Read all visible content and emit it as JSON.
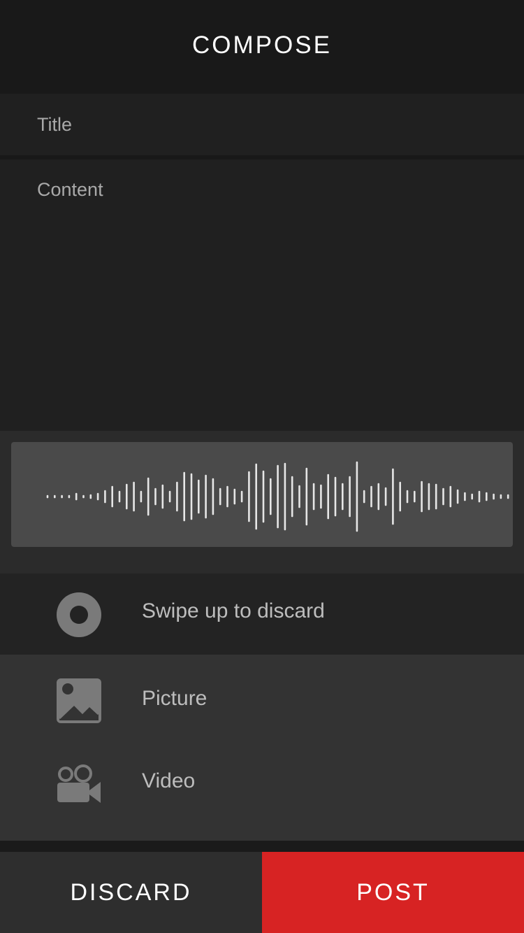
{
  "header": {
    "title": "COMPOSE"
  },
  "form": {
    "title_placeholder": "Title",
    "content_placeholder": "Content"
  },
  "recorder": {
    "discard_hint": "Swipe up to discard",
    "record_icon": "record-icon"
  },
  "attachments": [
    {
      "label": "Picture",
      "icon": "image-icon"
    },
    {
      "label": "Video",
      "icon": "video-camera-icon"
    }
  ],
  "actions": {
    "discard_label": "DISCARD",
    "post_label": "POST"
  },
  "colors": {
    "post_accent": "#d72323",
    "waveform": "#e6e6e6",
    "icon_grey": "#7a7a7a"
  }
}
